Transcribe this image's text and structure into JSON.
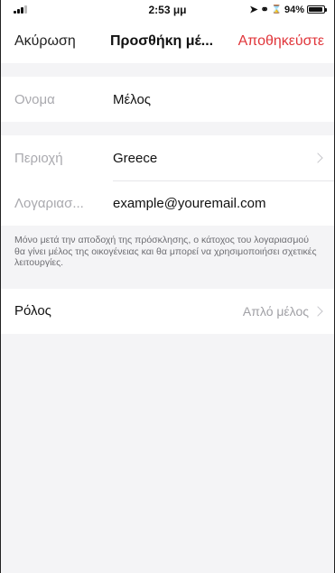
{
  "status_bar": {
    "time": "2:53 μμ",
    "battery": "94%",
    "battery_level": 0.94
  },
  "nav": {
    "cancel": "Ακύρωση",
    "title": "Προσθήκη μέ...",
    "save": "Αποθηκεύστε"
  },
  "form": {
    "name_label": "Ονομα",
    "name_value": "Μέλος",
    "region_label": "Περιοχή",
    "region_value": "Greece",
    "account_label": "Λογαριασ...",
    "account_value": "example@youremail.com"
  },
  "note": "Μόνο μετά την αποδοχή της πρόσκλησης, ο κάτοχος του λογαριασμού θα γίνει μέλος της οικογένειας και θα μπορεί να χρησιμοποιήσει σχετικές λειτουργίες.",
  "role": {
    "label": "Ρόλος",
    "value": "Απλό μέλος"
  },
  "colors": {
    "accent": "#e0353a",
    "background": "#f4f4f6"
  }
}
